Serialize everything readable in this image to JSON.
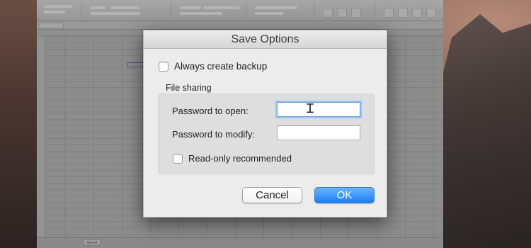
{
  "dialog": {
    "title": "Save Options",
    "always_backup": {
      "label": "Always create backup",
      "checked": false
    },
    "file_sharing": {
      "group_label": "File sharing",
      "password_open": {
        "label": "Password to open:",
        "value": ""
      },
      "password_modify": {
        "label": "Password to modify:",
        "value": ""
      },
      "read_only": {
        "label": "Read-only recommended",
        "checked": false
      }
    },
    "buttons": {
      "cancel": "Cancel",
      "ok": "OK"
    }
  },
  "spreadsheet": {
    "sheet_tab": "Sheet1"
  },
  "colors": {
    "ok_button": "#1c7ef3",
    "focus_ring": "#9cc3ee",
    "dialog_bg": "#ececec"
  }
}
